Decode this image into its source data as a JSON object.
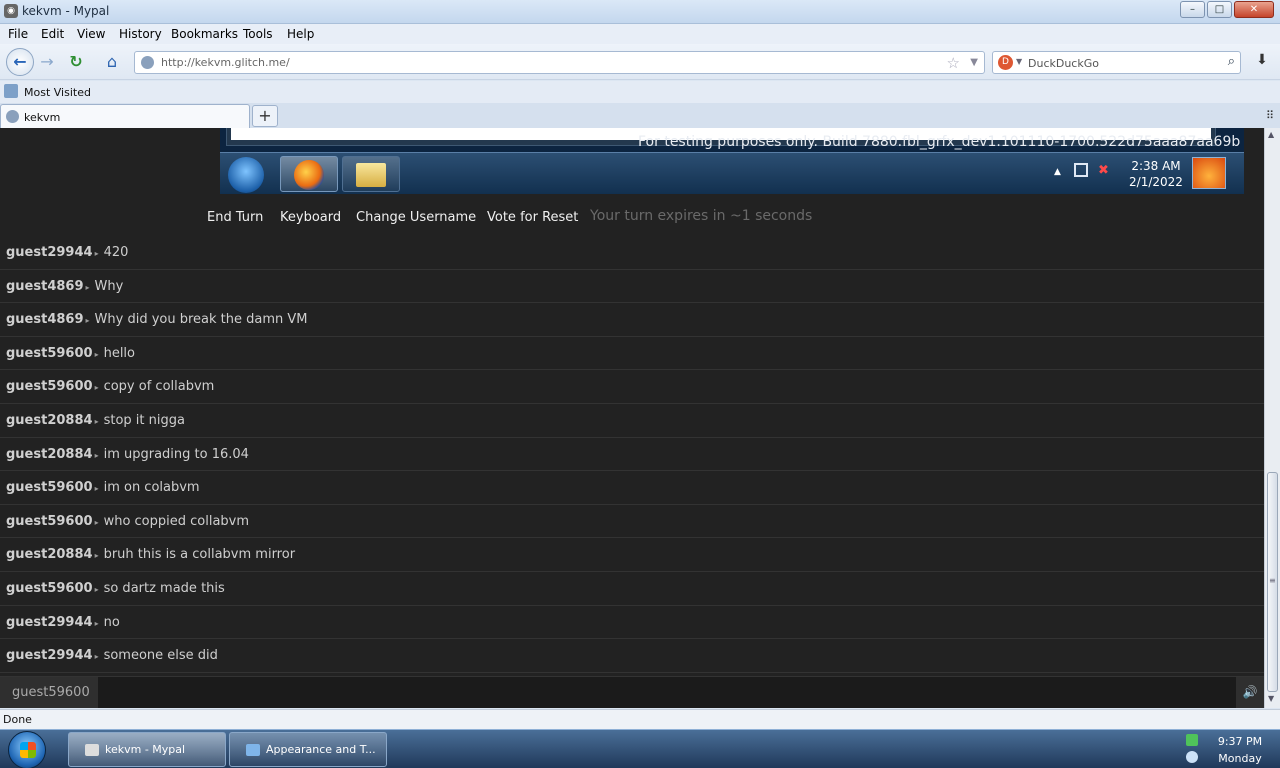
{
  "window": {
    "title": "kekvm - Mypal",
    "min_glyph": "–",
    "max_glyph": "□",
    "close_glyph": "✕"
  },
  "menu": [
    "File",
    "Edit",
    "View",
    "History",
    "Bookmarks",
    "Tools",
    "Help"
  ],
  "nav": {
    "back_glyph": "←",
    "forward_glyph": "→",
    "reload_glyph": "↻",
    "home_glyph": "⌂",
    "url": "http://kekvm.glitch.me/",
    "star_glyph": "☆",
    "dropdown_glyph": "▼",
    "search_placeholder": "DuckDuckGo",
    "search_glyph": "⌕",
    "download_glyph": "⬇"
  },
  "bookmarks": {
    "label": "Most Visited"
  },
  "tabs": [
    {
      "label": "kekvm"
    }
  ],
  "tabs_extra": {
    "new_tab_glyph": "+",
    "list_glyph": "⠿"
  },
  "vm": {
    "watermark": "For testing purposes only. Build 7880.fbl_grfx_dev1.101110-1700.522d75aaa87aa69b",
    "clock_time": "2:38 AM",
    "clock_date": "2/1/2022",
    "tray_up_glyph": "▲",
    "tray_vol_glyph": "✖"
  },
  "controls": {
    "end_turn": "End Turn",
    "keyboard": "Keyboard",
    "change_username": "Change Username",
    "vote_reset": "Vote for Reset",
    "turn_note": "Your turn expires in ~1 seconds"
  },
  "chat": [
    {
      "user": "guest29944",
      "text": "420"
    },
    {
      "user": "guest4869",
      "text": "Why"
    },
    {
      "user": "guest4869",
      "text": "Why did you break the damn VM"
    },
    {
      "user": "guest59600",
      "text": "hello"
    },
    {
      "user": "guest59600",
      "text": "copy of collabvm"
    },
    {
      "user": "guest20884",
      "text": "stop it nigga"
    },
    {
      "user": "guest20884",
      "text": "im upgrading to 16.04"
    },
    {
      "user": "guest59600",
      "text": "im on colabvm"
    },
    {
      "user": "guest59600",
      "text": "who coppied collabvm"
    },
    {
      "user": "guest20884",
      "text": "bruh this is a collabvm mirror"
    },
    {
      "user": "guest59600",
      "text": "so dartz made this"
    },
    {
      "user": "guest29944",
      "text": "no"
    },
    {
      "user": "guest29944",
      "text": "someone else did"
    }
  ],
  "chat_separator": "▸",
  "chat_input": {
    "username": "guest59600",
    "value": "",
    "speaker_glyph": "🔊"
  },
  "scrollbar": {
    "up_glyph": "▲",
    "down_glyph": "▼",
    "grip_glyph": "≡"
  },
  "status": "Done",
  "taskbar": {
    "items": [
      {
        "label": "kekvm - Mypal"
      },
      {
        "label": "Appearance and T..."
      }
    ],
    "time": "9:37 PM",
    "day": "Monday"
  }
}
